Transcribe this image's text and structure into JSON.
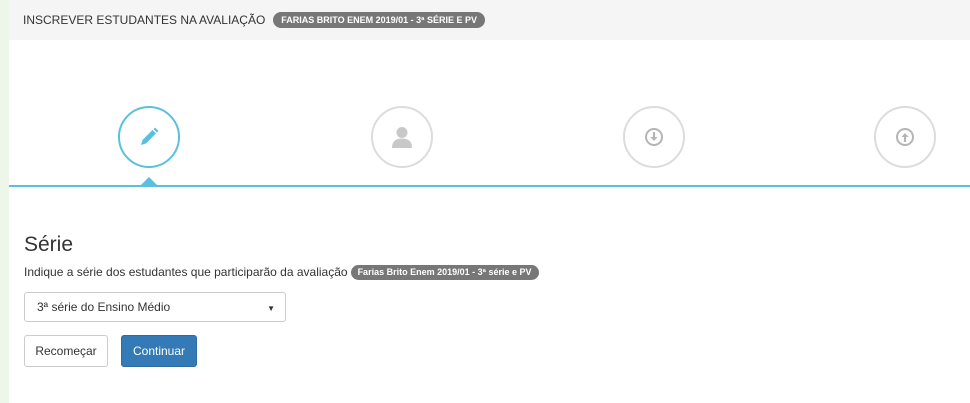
{
  "header": {
    "title": "INSCREVER ESTUDANTES NA AVALIAÇÃO",
    "badge": "FARIAS BRITO ENEM 2019/01 - 3ª SÉRIE E PV"
  },
  "steps": [
    {
      "icon": "pencil-icon",
      "active": true
    },
    {
      "icon": "user-icon",
      "active": false
    },
    {
      "icon": "arrow-down-circle-icon",
      "active": false
    },
    {
      "icon": "arrow-up-circle-icon",
      "active": false
    }
  ],
  "form": {
    "section_title": "Série",
    "help_text": "Indique a série dos estudantes que participarão da avaliação",
    "help_badge": "Farias Brito Enem 2019/01 - 3ª série e PV",
    "select_value": "3ª série do Ensino Médio"
  },
  "buttons": {
    "restart_label": "Recomeçar",
    "continue_label": "Continuar"
  },
  "colors": {
    "accent": "#5bc0de",
    "primary": "#337ab7",
    "badge": "#777777"
  }
}
